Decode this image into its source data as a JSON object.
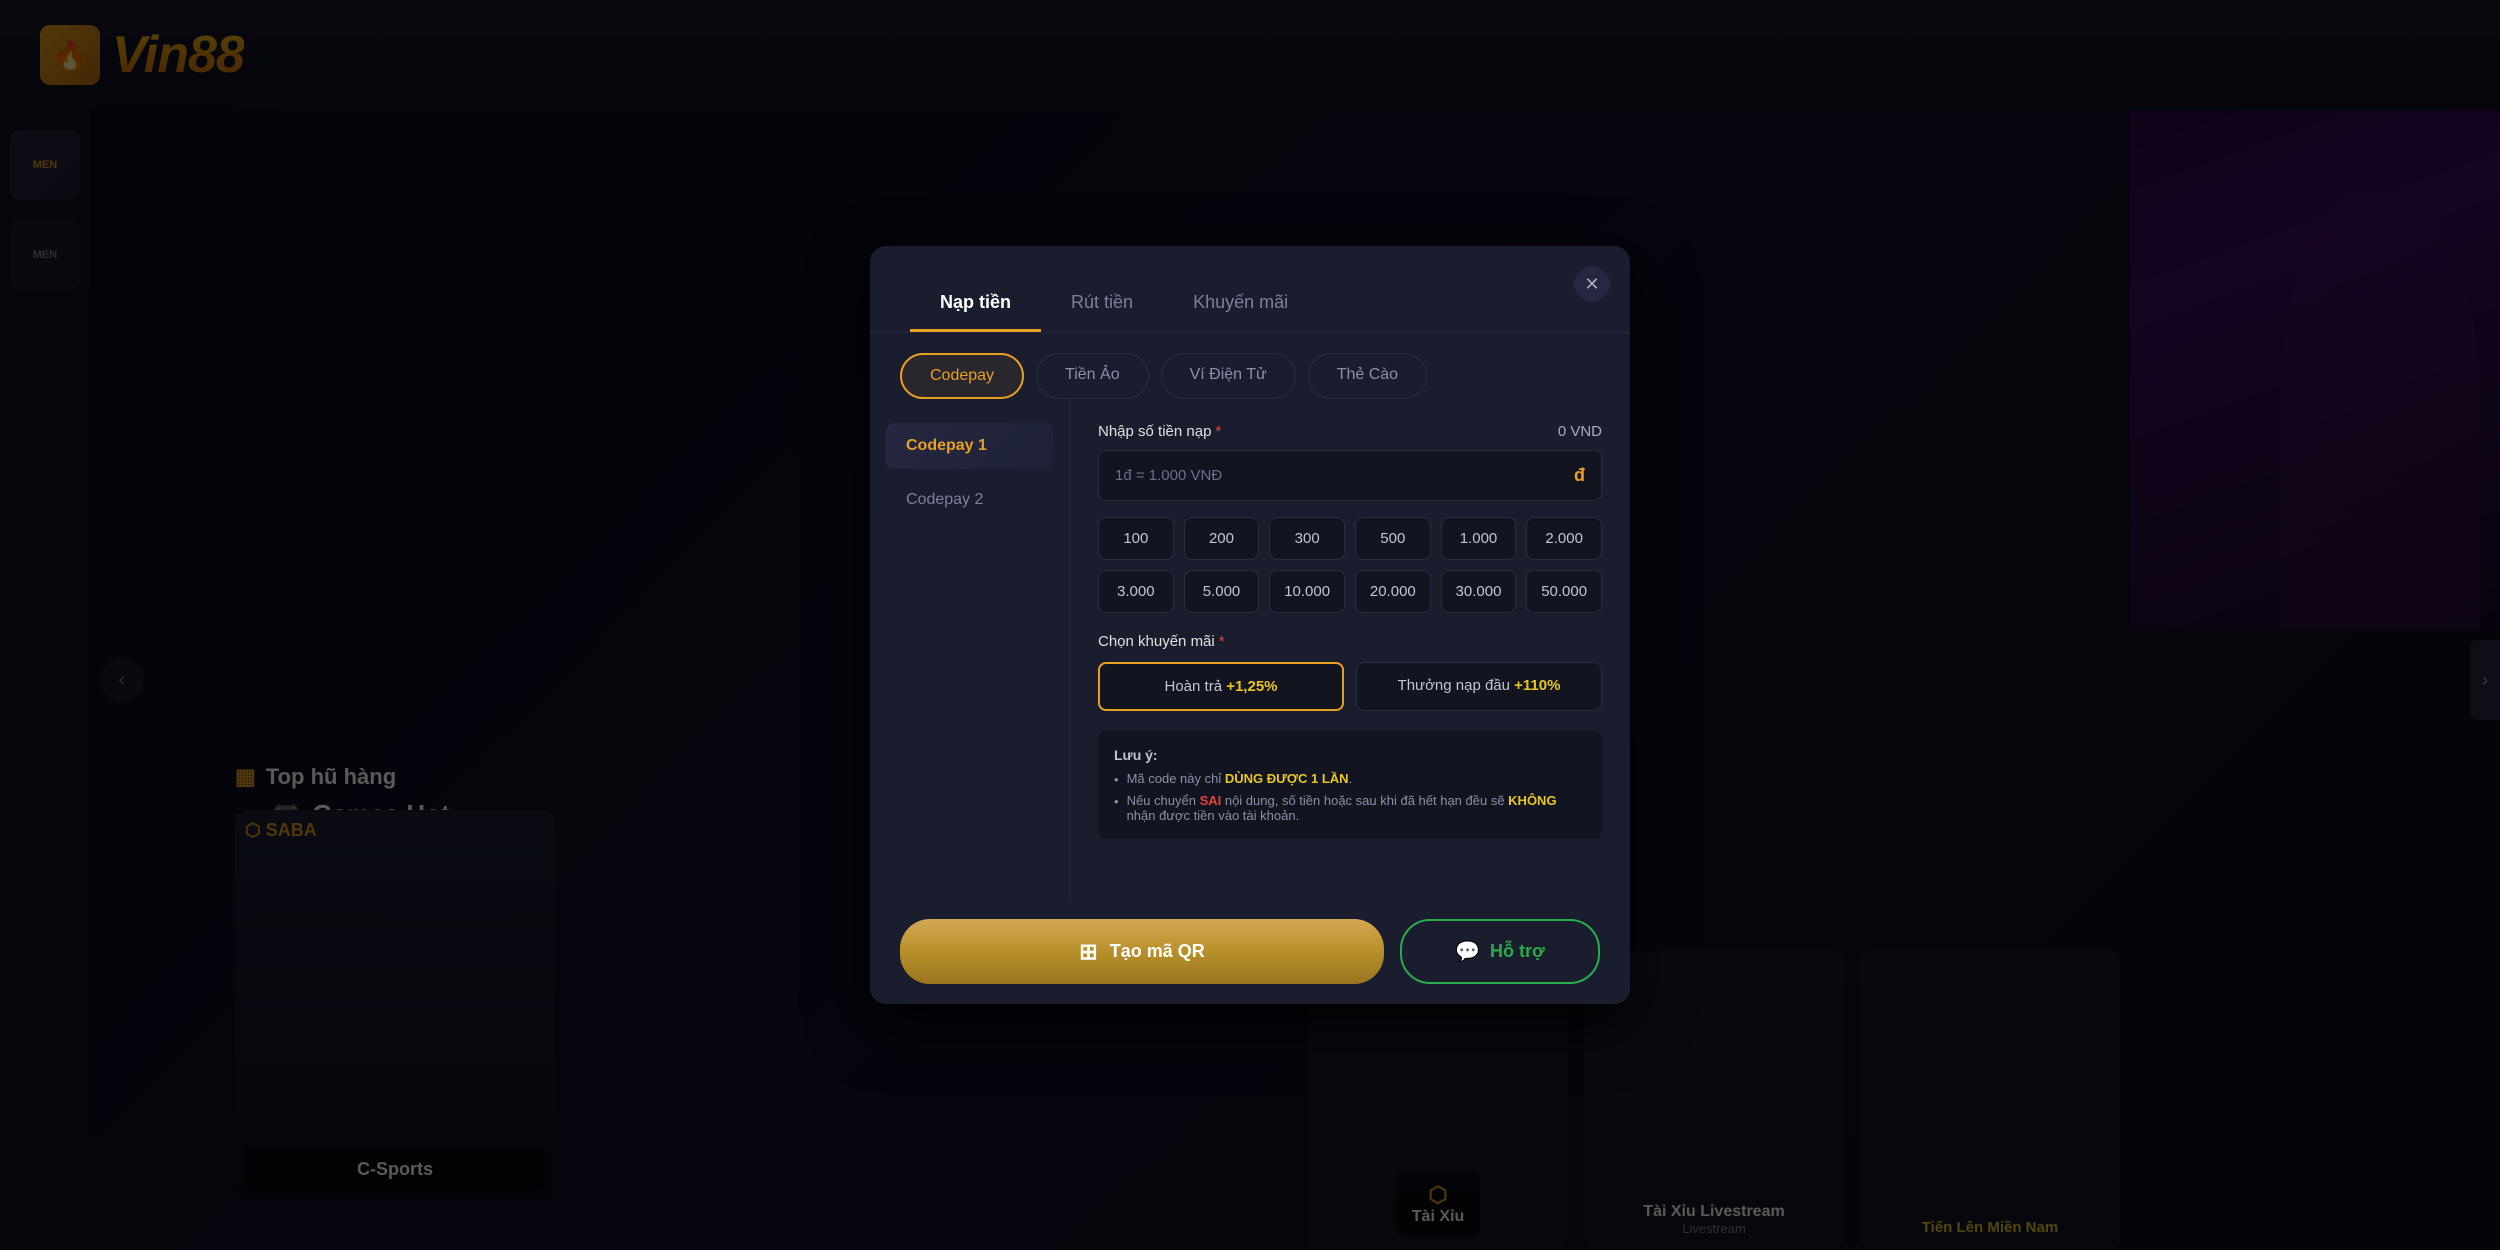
{
  "site": {
    "name": "Vin88",
    "logo_text": "Vin88"
  },
  "header": {
    "logo_alt": "Vin88 Logo"
  },
  "sidebar": {
    "items": [
      {
        "label": "MEN",
        "icon": "🎮"
      },
      {
        "label": "MEN",
        "icon": "🎯"
      }
    ]
  },
  "background": {
    "games_hot_label": "Games Hot",
    "top_hang_label": "Top hũ hàng",
    "c_sports_label": "C-Sports",
    "saba_label": "SABA",
    "tai_xiu_label": "Tài Xỉu",
    "tai_xiu_livestream": "Tài Xỉu Livestream",
    "tien_len_mien_nam": "Tiến Lên Miền Nam",
    "livestream_label": "Livestream"
  },
  "modal": {
    "close_icon": "✕",
    "tabs": [
      {
        "label": "Nạp tiền",
        "active": true
      },
      {
        "label": "Rút tiền",
        "active": false
      },
      {
        "label": "Khuyến mãi",
        "active": false
      }
    ],
    "payment_types": [
      {
        "label": "Codepay",
        "active": true
      },
      {
        "label": "Tiền Ảo",
        "active": false
      },
      {
        "label": "Ví Điện Tử",
        "active": false
      },
      {
        "label": "Thẻ Cào",
        "active": false
      }
    ],
    "payment_options": [
      {
        "label": "Codepay 1",
        "active": true
      },
      {
        "label": "Codepay 2",
        "active": false
      }
    ],
    "amount_label": "Nhập số tiền nạp",
    "amount_required": "*",
    "amount_display": "0 VND",
    "amount_placeholder": "1đ = 1.000 VNĐ",
    "amount_icon": "đ",
    "quick_amounts": [
      {
        "value": "100"
      },
      {
        "value": "200"
      },
      {
        "value": "300"
      },
      {
        "value": "500"
      },
      {
        "value": "1.000"
      },
      {
        "value": "2.000"
      },
      {
        "value": "3.000"
      },
      {
        "value": "5.000"
      },
      {
        "value": "10.000"
      },
      {
        "value": "20.000"
      },
      {
        "value": "30.000"
      },
      {
        "value": "50.000"
      }
    ],
    "promo_label": "Chọn khuyến mãi",
    "promo_required": "*",
    "promo_options": [
      {
        "label": "Hoàn trả +1,25%",
        "highlight": "+1,25%",
        "active": true
      },
      {
        "label": "Thưởng nạp đầu +110%",
        "highlight": "+110%",
        "active": false
      }
    ],
    "notes_title": "Lưu ý:",
    "notes": [
      {
        "text": "Mã code này chỉ ",
        "highlight_yellow": "DÙNG ĐƯỢC 1 LẦN",
        "highlight_end": "."
      },
      {
        "text": "Nếu chuyển ",
        "highlight_red": "SAI",
        "text2": " nội dung, số tiền hoặc sau khi đã hết hạn đều sẽ ",
        "highlight_yellow2": "KHÔNG",
        "text3": " nhận được tiền vào tài khoản."
      }
    ],
    "btn_qr_icon": "⊞",
    "btn_qr_label": "Tạo mã QR",
    "btn_support_icon": "💬",
    "btn_support_label": "Hỗ trợ"
  }
}
